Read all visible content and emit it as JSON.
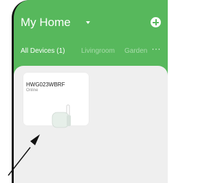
{
  "header": {
    "title": "My Home"
  },
  "tabs": [
    {
      "label": "All Devices (1)"
    },
    {
      "label": "Livingroom"
    },
    {
      "label": "Garden"
    }
  ],
  "more_label": "···",
  "device": {
    "name": "HWG023WBRF",
    "status": "Online"
  },
  "colors": {
    "primary": "#57b85c",
    "background": "#efefef"
  }
}
